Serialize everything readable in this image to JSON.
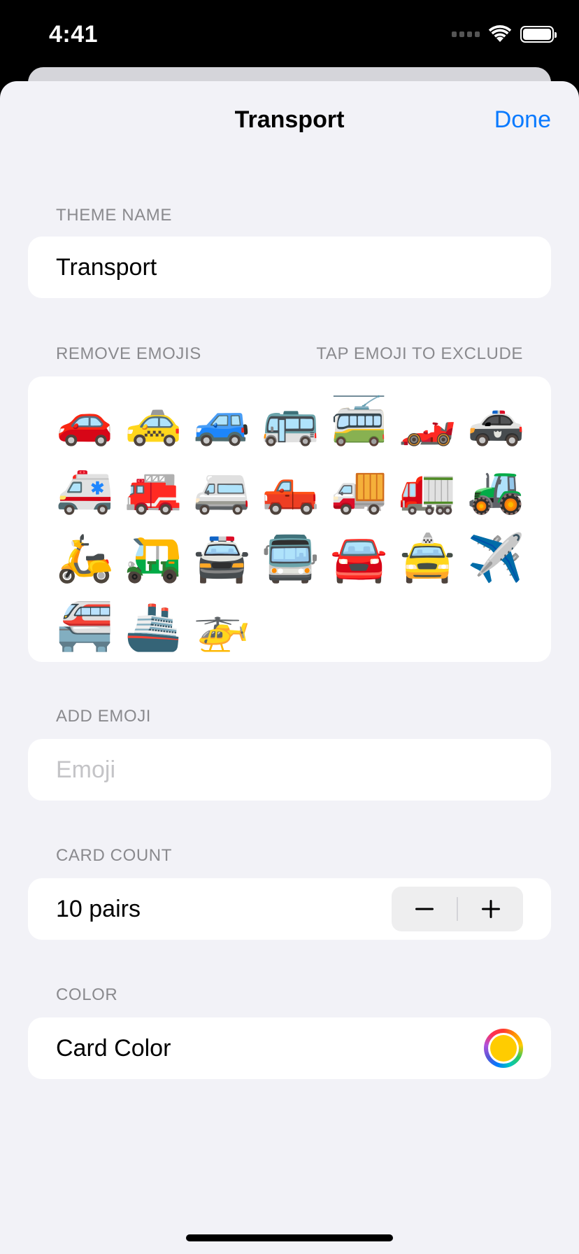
{
  "status_bar": {
    "time": "4:41"
  },
  "nav": {
    "title": "Transport",
    "done_label": "Done"
  },
  "theme_name": {
    "header": "THEME NAME",
    "value": "Transport"
  },
  "remove_emojis": {
    "header": "REMOVE EMOJIS",
    "hint": "TAP EMOJI TO EXCLUDE",
    "emojis": [
      "🚗",
      "🚕",
      "🚙",
      "🚌",
      "🚎",
      "🏎️",
      "🚓",
      "🚑",
      "🚒",
      "🚐",
      "🛻",
      "🚚",
      "🚛",
      "🚜",
      "🛵",
      "🛺",
      "🚔",
      "🚍",
      "🚘",
      "🚖",
      "✈️",
      "🚝",
      "🚢",
      "🚁"
    ]
  },
  "add_emoji": {
    "header": "ADD EMOJI",
    "placeholder": "Emoji",
    "value": ""
  },
  "card_count": {
    "header": "CARD COUNT",
    "label": "10 pairs"
  },
  "color": {
    "header": "COLOR",
    "label": "Card Color",
    "value": "#ffcc00"
  },
  "colors": {
    "accent": "#0a7aff",
    "background": "#f2f2f7",
    "secondary_text": "#8a8a8e"
  }
}
